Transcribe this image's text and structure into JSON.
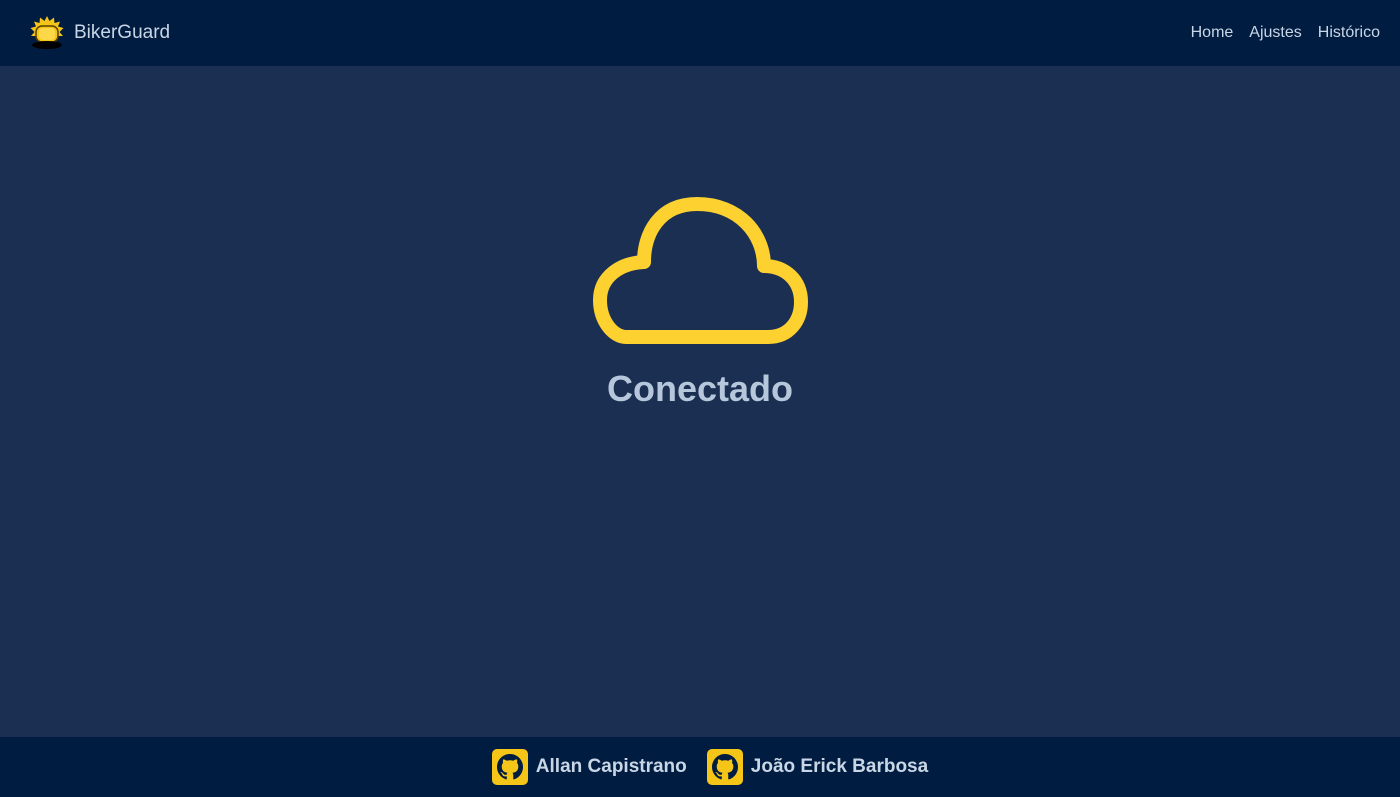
{
  "navbar": {
    "brand": "BikerGuard",
    "brand_icon": "siren-light-icon",
    "links": [
      "Home",
      "Ajustes",
      "Histórico"
    ]
  },
  "status": {
    "icon": "cloud-icon",
    "text": "Conectado"
  },
  "footer": {
    "authors": [
      {
        "name": "Allan Capistrano",
        "icon": "github-icon"
      },
      {
        "name": "João Erick Barbosa",
        "icon": "github-icon"
      }
    ]
  },
  "colors": {
    "background": "#1a2f52",
    "bar": "#001c40",
    "accent": "#f5c518",
    "text": "#c9d6e6"
  }
}
